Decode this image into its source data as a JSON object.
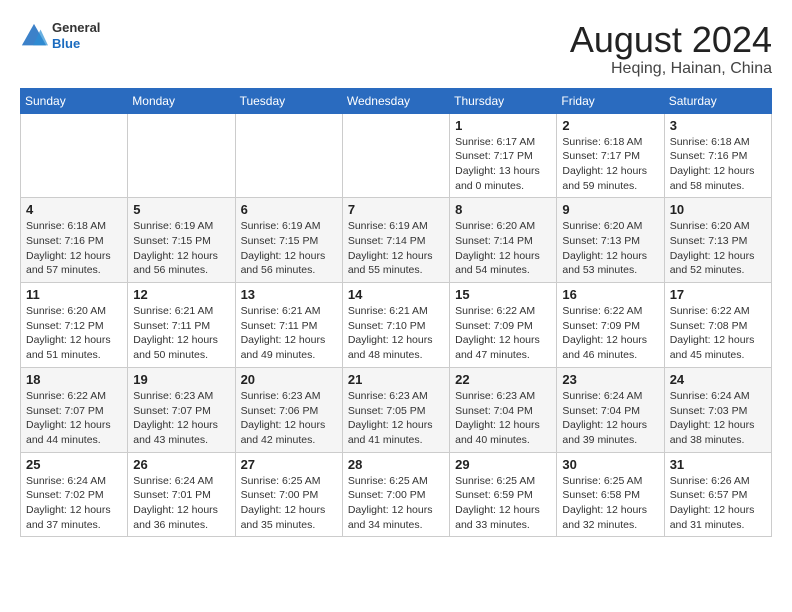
{
  "header": {
    "logo_general": "General",
    "logo_blue": "Blue",
    "month_title": "August 2024",
    "location": "Heqing, Hainan, China"
  },
  "weekdays": [
    "Sunday",
    "Monday",
    "Tuesday",
    "Wednesday",
    "Thursday",
    "Friday",
    "Saturday"
  ],
  "weeks": [
    [
      {
        "day": "",
        "sunrise": "",
        "sunset": "",
        "daylight": ""
      },
      {
        "day": "",
        "sunrise": "",
        "sunset": "",
        "daylight": ""
      },
      {
        "day": "",
        "sunrise": "",
        "sunset": "",
        "daylight": ""
      },
      {
        "day": "",
        "sunrise": "",
        "sunset": "",
        "daylight": ""
      },
      {
        "day": "1",
        "sunrise": "Sunrise: 6:17 AM",
        "sunset": "Sunset: 7:17 PM",
        "daylight": "Daylight: 13 hours and 0 minutes."
      },
      {
        "day": "2",
        "sunrise": "Sunrise: 6:18 AM",
        "sunset": "Sunset: 7:17 PM",
        "daylight": "Daylight: 12 hours and 59 minutes."
      },
      {
        "day": "3",
        "sunrise": "Sunrise: 6:18 AM",
        "sunset": "Sunset: 7:16 PM",
        "daylight": "Daylight: 12 hours and 58 minutes."
      }
    ],
    [
      {
        "day": "4",
        "sunrise": "Sunrise: 6:18 AM",
        "sunset": "Sunset: 7:16 PM",
        "daylight": "Daylight: 12 hours and 57 minutes."
      },
      {
        "day": "5",
        "sunrise": "Sunrise: 6:19 AM",
        "sunset": "Sunset: 7:15 PM",
        "daylight": "Daylight: 12 hours and 56 minutes."
      },
      {
        "day": "6",
        "sunrise": "Sunrise: 6:19 AM",
        "sunset": "Sunset: 7:15 PM",
        "daylight": "Daylight: 12 hours and 56 minutes."
      },
      {
        "day": "7",
        "sunrise": "Sunrise: 6:19 AM",
        "sunset": "Sunset: 7:14 PM",
        "daylight": "Daylight: 12 hours and 55 minutes."
      },
      {
        "day": "8",
        "sunrise": "Sunrise: 6:20 AM",
        "sunset": "Sunset: 7:14 PM",
        "daylight": "Daylight: 12 hours and 54 minutes."
      },
      {
        "day": "9",
        "sunrise": "Sunrise: 6:20 AM",
        "sunset": "Sunset: 7:13 PM",
        "daylight": "Daylight: 12 hours and 53 minutes."
      },
      {
        "day": "10",
        "sunrise": "Sunrise: 6:20 AM",
        "sunset": "Sunset: 7:13 PM",
        "daylight": "Daylight: 12 hours and 52 minutes."
      }
    ],
    [
      {
        "day": "11",
        "sunrise": "Sunrise: 6:20 AM",
        "sunset": "Sunset: 7:12 PM",
        "daylight": "Daylight: 12 hours and 51 minutes."
      },
      {
        "day": "12",
        "sunrise": "Sunrise: 6:21 AM",
        "sunset": "Sunset: 7:11 PM",
        "daylight": "Daylight: 12 hours and 50 minutes."
      },
      {
        "day": "13",
        "sunrise": "Sunrise: 6:21 AM",
        "sunset": "Sunset: 7:11 PM",
        "daylight": "Daylight: 12 hours and 49 minutes."
      },
      {
        "day": "14",
        "sunrise": "Sunrise: 6:21 AM",
        "sunset": "Sunset: 7:10 PM",
        "daylight": "Daylight: 12 hours and 48 minutes."
      },
      {
        "day": "15",
        "sunrise": "Sunrise: 6:22 AM",
        "sunset": "Sunset: 7:09 PM",
        "daylight": "Daylight: 12 hours and 47 minutes."
      },
      {
        "day": "16",
        "sunrise": "Sunrise: 6:22 AM",
        "sunset": "Sunset: 7:09 PM",
        "daylight": "Daylight: 12 hours and 46 minutes."
      },
      {
        "day": "17",
        "sunrise": "Sunrise: 6:22 AM",
        "sunset": "Sunset: 7:08 PM",
        "daylight": "Daylight: 12 hours and 45 minutes."
      }
    ],
    [
      {
        "day": "18",
        "sunrise": "Sunrise: 6:22 AM",
        "sunset": "Sunset: 7:07 PM",
        "daylight": "Daylight: 12 hours and 44 minutes."
      },
      {
        "day": "19",
        "sunrise": "Sunrise: 6:23 AM",
        "sunset": "Sunset: 7:07 PM",
        "daylight": "Daylight: 12 hours and 43 minutes."
      },
      {
        "day": "20",
        "sunrise": "Sunrise: 6:23 AM",
        "sunset": "Sunset: 7:06 PM",
        "daylight": "Daylight: 12 hours and 42 minutes."
      },
      {
        "day": "21",
        "sunrise": "Sunrise: 6:23 AM",
        "sunset": "Sunset: 7:05 PM",
        "daylight": "Daylight: 12 hours and 41 minutes."
      },
      {
        "day": "22",
        "sunrise": "Sunrise: 6:23 AM",
        "sunset": "Sunset: 7:04 PM",
        "daylight": "Daylight: 12 hours and 40 minutes."
      },
      {
        "day": "23",
        "sunrise": "Sunrise: 6:24 AM",
        "sunset": "Sunset: 7:04 PM",
        "daylight": "Daylight: 12 hours and 39 minutes."
      },
      {
        "day": "24",
        "sunrise": "Sunrise: 6:24 AM",
        "sunset": "Sunset: 7:03 PM",
        "daylight": "Daylight: 12 hours and 38 minutes."
      }
    ],
    [
      {
        "day": "25",
        "sunrise": "Sunrise: 6:24 AM",
        "sunset": "Sunset: 7:02 PM",
        "daylight": "Daylight: 12 hours and 37 minutes."
      },
      {
        "day": "26",
        "sunrise": "Sunrise: 6:24 AM",
        "sunset": "Sunset: 7:01 PM",
        "daylight": "Daylight: 12 hours and 36 minutes."
      },
      {
        "day": "27",
        "sunrise": "Sunrise: 6:25 AM",
        "sunset": "Sunset: 7:00 PM",
        "daylight": "Daylight: 12 hours and 35 minutes."
      },
      {
        "day": "28",
        "sunrise": "Sunrise: 6:25 AM",
        "sunset": "Sunset: 7:00 PM",
        "daylight": "Daylight: 12 hours and 34 minutes."
      },
      {
        "day": "29",
        "sunrise": "Sunrise: 6:25 AM",
        "sunset": "Sunset: 6:59 PM",
        "daylight": "Daylight: 12 hours and 33 minutes."
      },
      {
        "day": "30",
        "sunrise": "Sunrise: 6:25 AM",
        "sunset": "Sunset: 6:58 PM",
        "daylight": "Daylight: 12 hours and 32 minutes."
      },
      {
        "day": "31",
        "sunrise": "Sunrise: 6:26 AM",
        "sunset": "Sunset: 6:57 PM",
        "daylight": "Daylight: 12 hours and 31 minutes."
      }
    ]
  ]
}
